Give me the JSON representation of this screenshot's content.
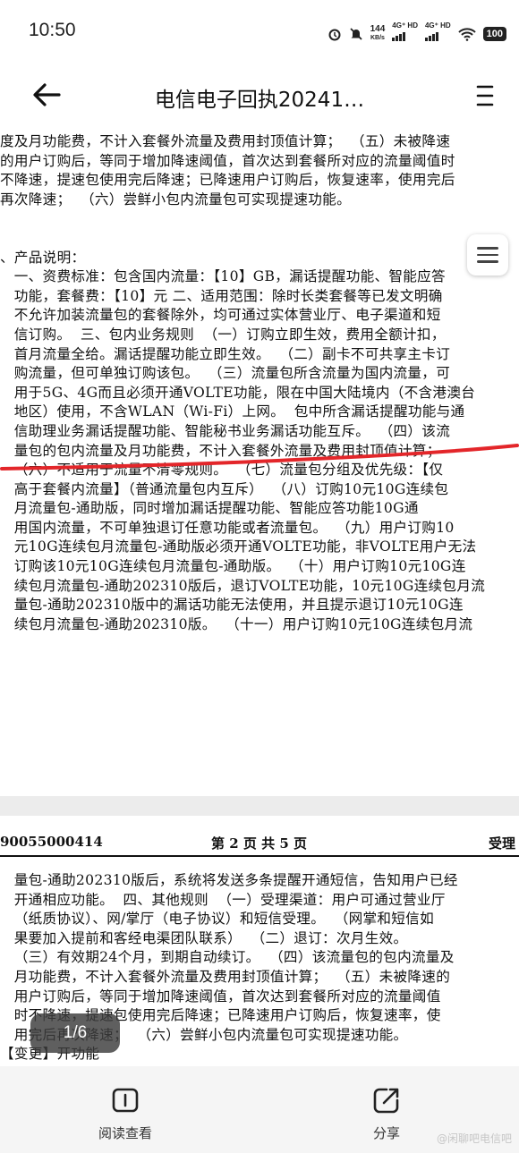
{
  "status_bar": {
    "time": "10:50",
    "speed_value": "144",
    "speed_unit": "KB/s",
    "network_1": "4G⁺ HD",
    "network_2": "4G⁺ HD",
    "battery": "100"
  },
  "header": {
    "title": "电信电子回执20241…"
  },
  "document": {
    "page1_lines": [
      "度及月功能费，不计入套餐外流量及费用封顶值计算；  （五）未被降速",
      "的用户订购后，等同于增加降速阈值，首次达到套餐所对应的流量阈值时",
      "不降速，提速包使用完后降速；已降速用户订购后，恢复速率，使用完后",
      "再次降速；  （六）尝鲜小包内流量包可实现提速功能。",
      "",
      "",
      "、产品说明：",
      "   一、资费标准：包含国内流量：【10】GB，漏话提醒功能、智能应答",
      "   功能，套餐费：【10】元 二、适用范围：除时长类套餐等已发文明确",
      "   不允许加装流量包的套餐除外，均可通过实体营业厅、电子渠道和短",
      "   信订购。  三、包内业务规则  （一）订购立即生效，费用全额计扣，",
      "   首月流量全给。漏话提醒功能立即生效。  （二）副卡不可共享主卡订",
      "   购流量，但可单独订购该包。  （三）流量包所含流量为国内流量，可",
      "   用于5G、4G而且必须开通VOLTE功能，限在中国大陆境内（不含港澳台",
      "   地区）使用，不含WLAN（Wi-Fi）上网。  包中所含漏话提醒功能与通",
      "   信助理业务漏话提醒功能、智能秘书业务漏话功能互斥。  （四）该流",
      "   量包的包内流量及月功能费，不计入套餐外流量及费用封顶值计算；",
      "   （六）不适用于流量不清零规则。  （七）流量包分组及优先级：【仅",
      "   高于套餐内流量】（普通流量包内互斥）  （八）订购10元10G连续包",
      "   月流量包-通助版，同时增加漏话提醒功能、智能应答功能10G通",
      "   用国内流量，不可单独退订任意功能或者流量包。  （九）用户订购10",
      "   元10G连续包月流量包-通助版必须开通VOLTE功能，非VOLTE用户无法",
      "   订购该10元10G连续包月流量包-通助版。  （十）用户订购10元10G连",
      "   续包月流量包-通助202310版后，退订VOLTE功能，10元10G连续包月流",
      "   量包-通助202310版中的漏话功能无法使用，并且提示退订10元10G连",
      "   续包月流量包-通助202310版。  （十一）用户订购10元10G连续包月流"
    ],
    "page2_header_left": "90055000414",
    "page2_header_center": "第 2 页 共 5 页",
    "page2_header_right": "受理",
    "page2_lines": [
      "   量包-通助202310版后，系统将发送多条提醒开通短信，告知用户已经",
      "   开通相应功能。  四、其他规则  （一）受理渠道：用户可通过营业厅",
      "   （纸质协议）、网/掌厅（电子协议）和短信受理。  （网掌和短信如",
      "   果要加入提前和客经电渠团队联系）  （二）退订：次月生效。",
      "   （三）有效期24个月，到期自动续订。  （四）该流量包的包内流量及",
      "   月功能费，不计入套餐外流量及费用封顶值计算；  （五）未被降速的",
      "   用户订购后，等同于增加降速阈值，首次达到套餐所对应的流量阈值",
      "   时不降速，提速包使用完后降速；已降速用户订购后，恢复速率，使",
      "   用完后再次降速；  （六）尝鲜小包内流量包可实现提速功能。",
      "【变更】开功能"
    ]
  },
  "page_indicator": "1/6",
  "bottom_bar": {
    "read_label": "阅读查看",
    "share_label": "分享"
  },
  "watermark": "@闲聊吧电信吧"
}
